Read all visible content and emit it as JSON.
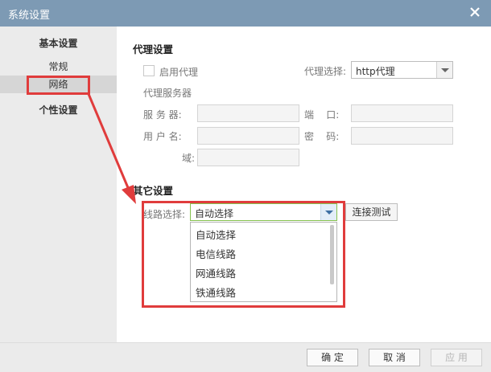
{
  "window": {
    "title": "系统设置"
  },
  "sidebar": {
    "header_basic": "基本设置",
    "items": [
      {
        "label": "常规"
      },
      {
        "label": "网络"
      }
    ],
    "header_personal": "个性设置"
  },
  "proxy": {
    "section_title": "代理设置",
    "enable_label": "启用代理",
    "select_label": "代理选择:",
    "select_value": "http代理",
    "server_label": "代理服务器",
    "server_field_label": "服 务 器:",
    "port_label": "端    口:",
    "user_label": "用 户 名:",
    "password_label": "密    码:",
    "domain_label": "域:"
  },
  "other": {
    "section_title": "其它设置",
    "route_label": "线路选择:",
    "route_value": "自动选择",
    "test_button": "连接测试",
    "route_options": [
      "自动选择",
      "电信线路",
      "网通线路",
      "铁通线路"
    ]
  },
  "footer": {
    "ok": "确 定",
    "cancel": "取 消",
    "apply": "应 用"
  },
  "colors": {
    "titlebar": "#7d9ab4",
    "annotation": "#e03c3c",
    "active_border": "#86c24f"
  }
}
